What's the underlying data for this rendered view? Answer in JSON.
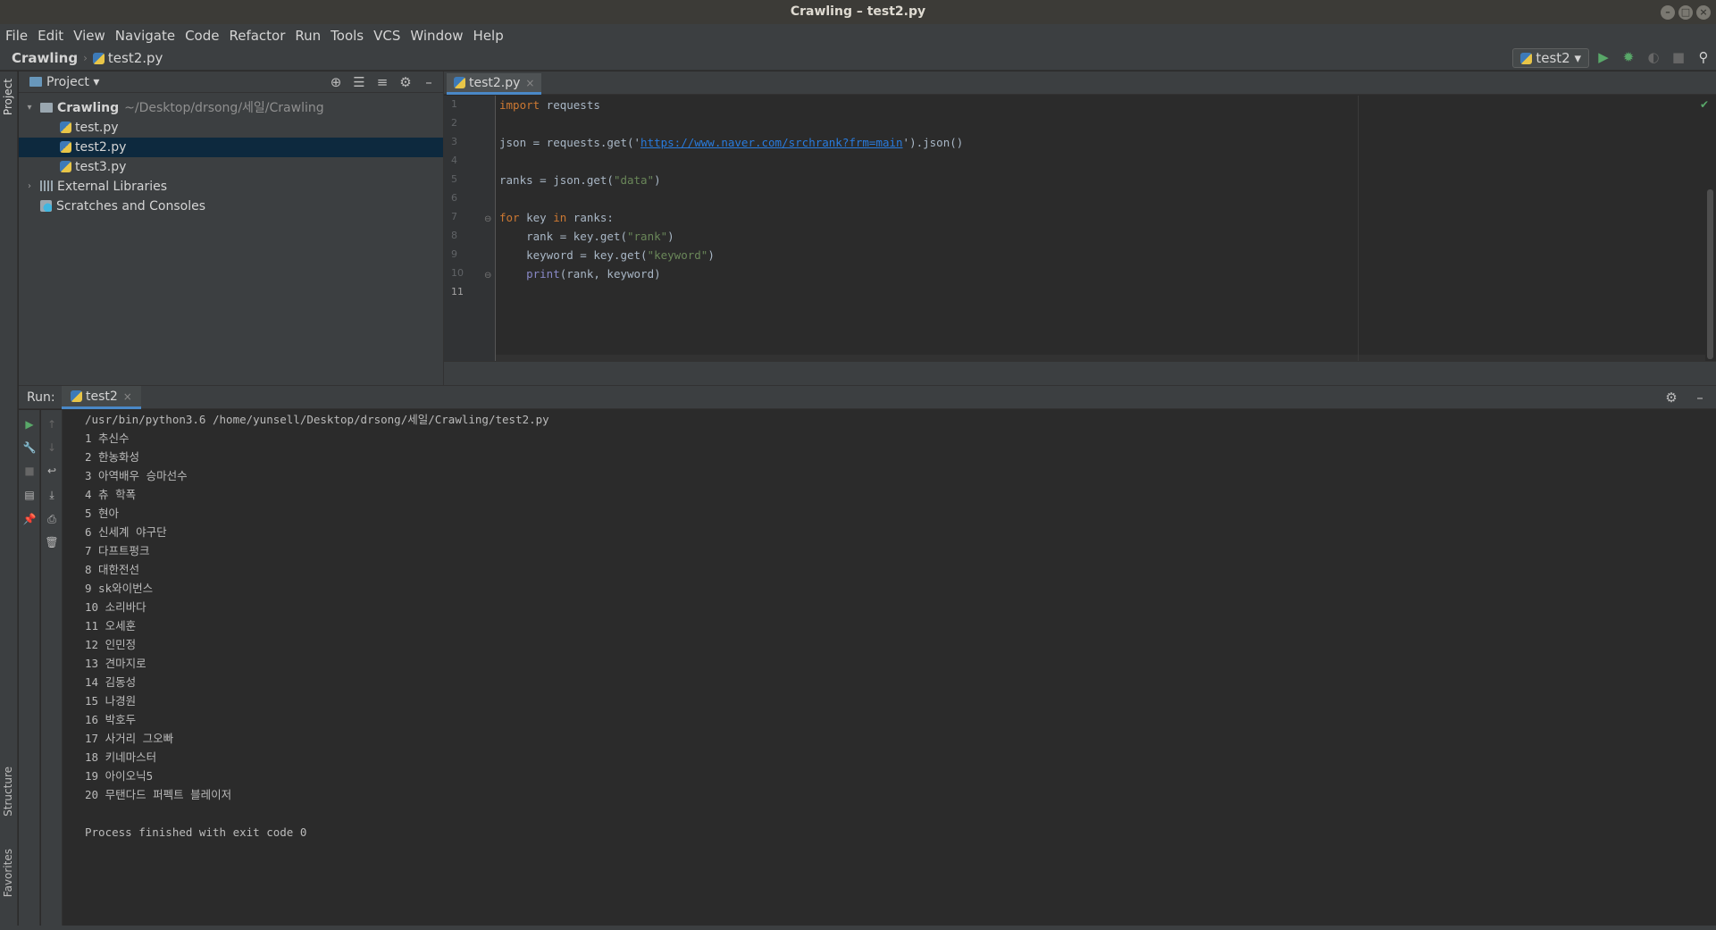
{
  "window": {
    "title": "Crawling – test2.py"
  },
  "menu": [
    "File",
    "Edit",
    "View",
    "Navigate",
    "Code",
    "Refactor",
    "Run",
    "Tools",
    "VCS",
    "Window",
    "Help"
  ],
  "breadcrumb": {
    "project": "Crawling",
    "file": "test2.py"
  },
  "run_config": {
    "label": "test2 ▾"
  },
  "left_strip": {
    "project": "Project",
    "structure": "Structure",
    "favorites": "Favorites"
  },
  "project_panel": {
    "title": "Project ▾",
    "root": {
      "name": "Crawling",
      "path": "~/Desktop/drsong/세일/Crawling"
    },
    "files": [
      "test.py",
      "test2.py",
      "test3.py"
    ],
    "selected_file": "test2.py",
    "external_libraries": "External Libraries",
    "scratches": "Scratches and Consoles"
  },
  "editor": {
    "tab_label": "test2.py",
    "line_numbers": [
      "1",
      "2",
      "3",
      "4",
      "5",
      "6",
      "7",
      "8",
      "9",
      "10",
      "11"
    ],
    "current_line": "11",
    "code": {
      "l1_kw": "import",
      "l1_rest": " requests",
      "l3_a": "json = requests.get('",
      "l3_url": "https://www.naver.com/srchrank?frm=main",
      "l3_b": "').json()",
      "l5_a": "ranks = json.get(",
      "l5_str": "\"data\"",
      "l5_b": ")",
      "l7_kw1": "for",
      "l7_mid": " key ",
      "l7_kw2": "in",
      "l7_rest": " ranks:",
      "l8_a": "    rank = key.get(",
      "l8_str": "\"rank\"",
      "l8_b": ")",
      "l9_a": "    keyword = key.get(",
      "l9_str": "\"keyword\"",
      "l9_b": ")",
      "l10_a": "    ",
      "l10_bi": "print",
      "l10_b": "(rank, keyword)"
    }
  },
  "run_panel": {
    "label": "Run:",
    "tab_label": "test2",
    "command": "/usr/bin/python3.6 /home/yunsell/Desktop/drsong/세일/Crawling/test2.py",
    "output": [
      "1 추신수",
      "2 한농화성",
      "3 아역배우 승마선수",
      "4 츄 학폭",
      "5 현아",
      "6 신세계 야구단",
      "7 다프트펑크",
      "8 대한전선",
      "9 sk와이번스",
      "10 소리바다",
      "11 오세훈",
      "12 인민정",
      "13 견마지로",
      "14 김동성",
      "15 나경원",
      "16 박호두",
      "17 사거리 그오빠",
      "18 키네마스터",
      "19 아이오닉5",
      "20 무탠다드 퍼펙트 블레이저"
    ],
    "exit_message": "Process finished with exit code 0"
  },
  "colors": {
    "accent": "#4a88c7",
    "selection": "#0d293e",
    "keyword": "#cc7832",
    "string": "#6a8759",
    "run_green": "#59a869"
  }
}
